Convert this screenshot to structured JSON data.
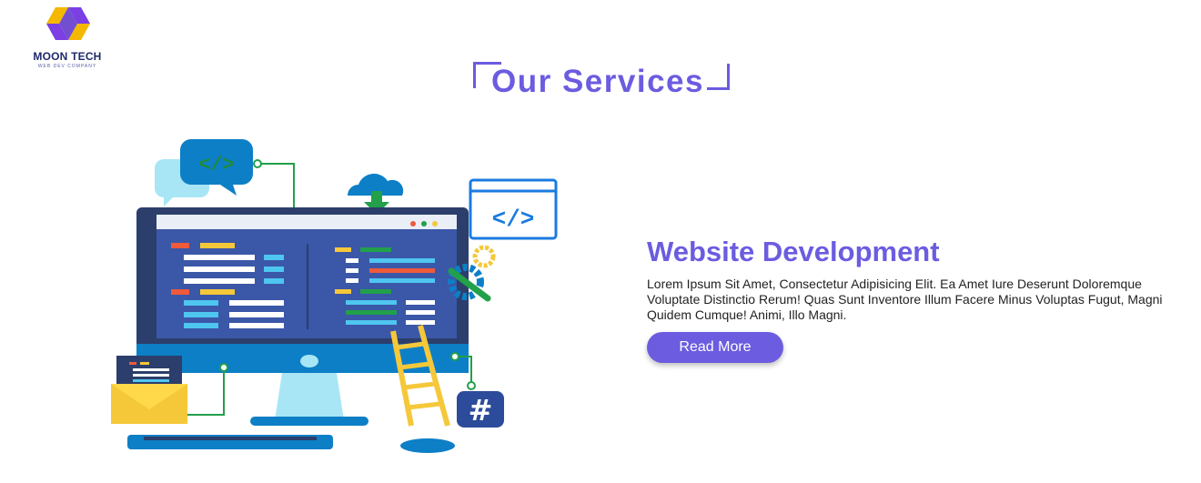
{
  "brand": {
    "name": "MOON TECH",
    "tagline": "WEB DEV COMPANY",
    "colors": {
      "primary": "#6b5ce0",
      "logo_yellow": "#f5b800",
      "logo_purple": "#7b3fe4"
    }
  },
  "section": {
    "heading": "Our Services"
  },
  "service": {
    "title": "Website Development",
    "description": "Lorem Ipsum Sit Amet, Consectetur Adipisicing Elit. Ea Amet Iure Deserunt Doloremque Voluptate Distinctio Rerum! Quas Sunt Inventore Illum Facere Minus Voluptas Fugut, Magni Quidem Cumque! Animi, Illo Magni.",
    "button_label": "Read More"
  },
  "illustration": {
    "code_badge_1": "</>",
    "code_badge_2": "</>",
    "hash_badge": "#"
  }
}
